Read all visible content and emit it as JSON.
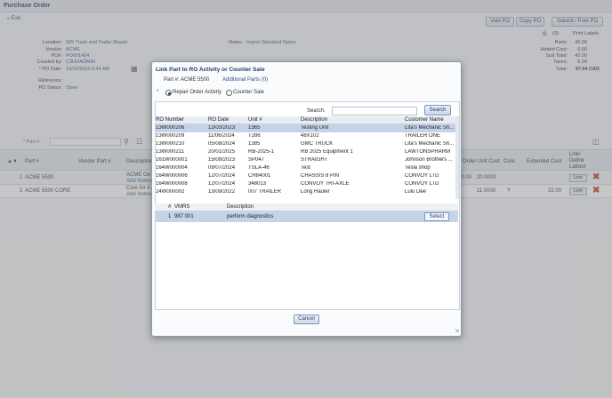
{
  "page": {
    "title": "Purchase Order",
    "exit_label": "Exit"
  },
  "toolbar": {
    "void_po": "Void PO",
    "copy_po": "Copy PO",
    "submit_print": "Submit / Print PO"
  },
  "sub_toolbar": {
    "count": "(0)",
    "print_labels": "Print Labels"
  },
  "po": {
    "location_label": "Location:",
    "location": "905 Truck and Trailer Repair",
    "vendor_label": "Vendor:",
    "vendor": "ACME",
    "po_label": "PO#:",
    "po_number": "PO001424",
    "created_label": "Created by:",
    "created_by": "C3HOADMIN",
    "date_label": "* PO Date:",
    "date": "13/02/2025 8:44 AM",
    "reference_label": "Reference:",
    "status_label": "PO Status:",
    "status": "Open",
    "notes_label": "Notes:",
    "notes": "Import Standard Notes"
  },
  "summary": {
    "parts_label": "Parts:",
    "parts": "40.00",
    "added_label": "Added Cost:",
    "added": "0.00",
    "sub_label": "Sub Total:",
    "sub": "42.00",
    "taxes_label": "Taxes:",
    "taxes": "5.04",
    "total_label": "Total:",
    "total": "47.04 CAD"
  },
  "grid": {
    "part_search_placeholder": "* Part #:",
    "headers": {
      "part": "Part #",
      "vendor_part": "Vendor Part #",
      "description": "Description",
      "order_unit_cost": "Order Unit Cost",
      "core": "Core",
      "extended_cost": "Extended Cost",
      "link": "Link/ Delink Labour"
    },
    "rows": [
      {
        "num": "1",
        "part": "ACME 5500",
        "desc": "ACME Ge",
        "notes": "Add Notes",
        "qty": "20.00",
        "unit_cost": "20.0000",
        "core": "",
        "ext": "",
        "link": "Link"
      },
      {
        "num": "2",
        "part": "ACME 5500 CORE",
        "desc": "Core for A",
        "notes": "Add Notes",
        "qty": "",
        "unit_cost": "11.0000",
        "core": "Y",
        "ext": "22.00",
        "link": "Link"
      }
    ]
  },
  "modal": {
    "title": "Link Part to RO Activity or Counter Sale",
    "part_line": "Part #: ACME 5500",
    "additional_parts": "Additional Parts (0)",
    "required_mark": "*",
    "radio_repair": "Repair Order Activity",
    "radio_counter": "Counter Sale",
    "search_label": "Search:",
    "search_button": "Search",
    "ro_headers": {
      "ro_number": "RO Number",
      "ro_date": "RO Date",
      "unit": "Unit #",
      "description": "Description",
      "customer": "Customer Name"
    },
    "ro_rows": [
      {
        "ro": "13W000206",
        "date": "13/03/2023",
        "unit": "1365",
        "desc": "Testing Unit",
        "cust": "Lita's Mechanic Sh..."
      },
      {
        "ro": "13W000209",
        "date": "11/06/2024",
        "unit": "T286",
        "desc": "48X102",
        "cust": "TRAILER ONE"
      },
      {
        "ro": "13W000210",
        "date": "05/08/2024",
        "unit": "1385",
        "desc": "GMC TRUCK",
        "cust": "Lita's Mechanic Sh..."
      },
      {
        "ro": "13W000211",
        "date": "20/01/2025",
        "unit": "RB-2025-1",
        "desc": "RB 2025 Equipment 1",
        "cust": "LAWTONSPHARM"
      },
      {
        "ro": "161W000001",
        "date": "15/09/2023",
        "unit": "SP047",
        "desc": "STRAIGHT",
        "cust": "Johnson Brothers ..."
      },
      {
        "ro": "164W000004",
        "date": "09/07/2024",
        "unit": "TSLA-46",
        "desc": "Test",
        "cust": "Tesla shop"
      },
      {
        "ro": "164W000006",
        "date": "12/07/2024",
        "unit": "CH84001",
        "desc": "CHASSIS 8 PIN",
        "cust": "CONVOY LTD"
      },
      {
        "ro": "164W000008",
        "date": "12/07/2024",
        "unit": "348013",
        "desc": "CONVOY TRI-AXLE",
        "cust": "CONVOY LTD"
      },
      {
        "ro": "24W000002",
        "date": "13/09/2022",
        "unit": "007 TRAILER",
        "desc": "Long Hauler",
        "cust": "Lulu Dee"
      }
    ],
    "vmrs_headers": {
      "num": "#",
      "vmrs": "VMRS",
      "description": "Description"
    },
    "vmrs_rows": [
      {
        "num": "1",
        "vmrs": "987 001",
        "desc": "perform diagnostics",
        "action": "Select"
      }
    ],
    "cancel": "Cancel"
  }
}
